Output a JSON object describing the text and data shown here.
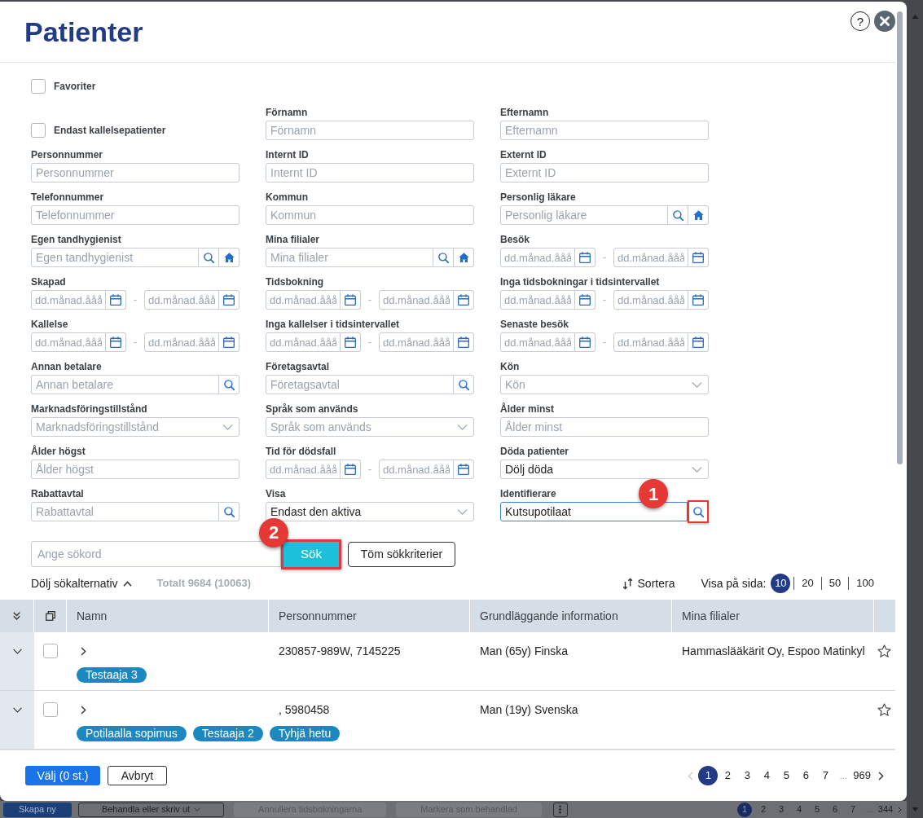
{
  "window": {
    "title": "Patienter",
    "help_label": "?"
  },
  "favorites": {
    "label": "Favoriter",
    "checked": false
  },
  "filters": [
    {
      "kind": "checkbox",
      "label": "Endast kallelsepatienter",
      "checked": false
    },
    {
      "kind": "text",
      "label": "Förnamn",
      "placeholder": "Förnamn",
      "focused": false
    },
    {
      "kind": "text",
      "label": "Efternamn",
      "placeholder": "Efternamn",
      "focused": false
    },
    {
      "kind": "text",
      "label": "Personnummer",
      "placeholder": "Personnummer",
      "focused": false
    },
    {
      "kind": "text",
      "label": "Internt ID",
      "placeholder": "Internt ID",
      "focused": false
    },
    {
      "kind": "text",
      "label": "Externt ID",
      "placeholder": "Externt ID",
      "focused": false
    },
    {
      "kind": "text",
      "label": "Telefonnummer",
      "placeholder": "Telefonnummer",
      "focused": false
    },
    {
      "kind": "text",
      "label": "Kommun",
      "placeholder": "Kommun",
      "focused": false
    },
    {
      "kind": "lookup",
      "label": "Personlig läkare",
      "placeholder": "Personlig läkare",
      "focused": false
    },
    {
      "kind": "lookup",
      "label": "Egen tandhygienist",
      "placeholder": "Egen tandhygienist",
      "focused": false
    },
    {
      "kind": "lookup",
      "label": "Mina filialer",
      "placeholder": "Mina filialer",
      "focused": false
    },
    {
      "kind": "date_range",
      "label": "Besök",
      "from_placeholder": "dd.månad.ååå",
      "separator": "-",
      "to_placeholder": "dd.månad.ååå"
    },
    {
      "kind": "date_range",
      "label": "Skapad",
      "from_placeholder": "dd.månad.ååå",
      "separator": "-",
      "to_placeholder": "dd.månad.ååå"
    },
    {
      "kind": "date_range",
      "label": "Tidsbokning",
      "from_placeholder": "dd.månad.ååå",
      "separator": "-",
      "to_placeholder": "dd.månad.ååå"
    },
    {
      "kind": "date_range",
      "label": "Inga tidsbokningar i tidsintervallet",
      "from_placeholder": "dd.månad.ååå",
      "separator": "-",
      "to_placeholder": "dd.månad.ååå"
    },
    {
      "kind": "date_range",
      "label": "Kallelse",
      "from_placeholder": "dd.månad.ååå",
      "separator": "-",
      "to_placeholder": "dd.månad.ååå"
    },
    {
      "kind": "date_range",
      "label": "Inga kallelser i tidsintervallet",
      "from_placeholder": "dd.månad.ååå",
      "separator": "-",
      "to_placeholder": "dd.månad.ååå"
    },
    {
      "kind": "date_range",
      "label": "Senaste besök",
      "from_placeholder": "dd.månad.ååå",
      "separator": "-",
      "to_placeholder": "dd.månad.ååå"
    },
    {
      "kind": "search",
      "label": "Annan betalare",
      "placeholder": "Annan betalare",
      "focused": false
    },
    {
      "kind": "search",
      "label": "Företagsavtal",
      "placeholder": "Företagsavtal",
      "focused": false
    },
    {
      "kind": "select",
      "label": "Kön",
      "placeholder": "Kön",
      "focused": false
    },
    {
      "kind": "select",
      "label": "Marknadsföringstillstånd",
      "placeholder": "Marknadsföringstillstånd",
      "focused": false
    },
    {
      "kind": "select",
      "label": "Språk som används",
      "placeholder": "Språk som används",
      "focused": false
    },
    {
      "kind": "text",
      "label": "Ålder minst",
      "placeholder": "Ålder minst",
      "focused": false
    },
    {
      "kind": "text",
      "label": "Ålder högst",
      "placeholder": "Ålder högst",
      "focused": false
    },
    {
      "kind": "date_range",
      "label": "Tid för dödsfall",
      "from_placeholder": "dd.månad.ååå",
      "separator": "-",
      "to_placeholder": "dd.månad.ååå"
    },
    {
      "kind": "select",
      "label": "Döda patienter",
      "value": "Dölj döda",
      "focused": false
    },
    {
      "kind": "search",
      "label": "Rabattavtal",
      "placeholder": "Rabattavtal",
      "focused": false
    },
    {
      "kind": "select",
      "label": "Visa",
      "value": "Endast den aktiva",
      "focused": false
    },
    {
      "kind": "search",
      "label": "Identifierare",
      "value": "Kutsupotilaat",
      "focused": true,
      "annotation": "1"
    }
  ],
  "search": {
    "placeholder": "Ange sökord",
    "submit_label": "Sök",
    "submit_annotation": "2",
    "clear_label": "Töm sökkriterier"
  },
  "results": {
    "toggle_label": "Dölj sökalternativ",
    "total": "Totalt 9684 (10063)",
    "sort_label": "Sortera",
    "page_size_label": "Visa på sida:",
    "page_sizes": [
      {
        "label": "10",
        "selected": true
      },
      {
        "label": "20",
        "selected": false
      },
      {
        "label": "50",
        "selected": false
      },
      {
        "label": "100",
        "selected": false
      }
    ]
  },
  "table": {
    "columns": [
      "Namn",
      "Personnummer",
      "Grundläggande information",
      "Mina filialer"
    ],
    "rows": [
      {
        "checked": false,
        "favorite": false,
        "personnummer": "230857-989W, 7145225",
        "info": "Man (65y) Finska",
        "branches": "Hammaslääkärit Oy, Espoo Matinkyl",
        "tags": [
          "Testaaja 3"
        ]
      },
      {
        "checked": false,
        "favorite": false,
        "personnummer": ", 5980458",
        "info": "Man (19y) Svenska",
        "tags": [
          "Potilaalla sopimus",
          "Testaaja 2",
          "Tyhjä hetu"
        ]
      }
    ]
  },
  "footer": {
    "select_label": "Välj (0 st.)",
    "cancel_label": "Avbryt",
    "pagination": {
      "prev_disabled": true,
      "next_disabled": false,
      "pages": [
        {
          "kind": "page",
          "label": "1",
          "selected": true
        },
        {
          "kind": "page",
          "label": "2",
          "selected": false
        },
        {
          "kind": "page",
          "label": "3",
          "selected": false
        },
        {
          "kind": "page",
          "label": "4",
          "selected": false
        },
        {
          "kind": "page",
          "label": "5",
          "selected": false
        },
        {
          "kind": "page",
          "label": "6",
          "selected": false
        },
        {
          "kind": "page",
          "label": "7",
          "selected": false
        },
        {
          "kind": "ellipsis",
          "label": "...",
          "selected": false
        },
        {
          "kind": "page",
          "label": "969",
          "selected": false
        }
      ]
    }
  },
  "background_page": {
    "buttons": [
      {
        "kind": "primary",
        "label": "Skapa ny"
      },
      {
        "kind": "menu",
        "label": "Behandla eller skriv ut"
      },
      {
        "kind": "disabled",
        "label": "Annullera tidsbokningarna"
      },
      {
        "kind": "disabled",
        "label": "Markera som behandlad"
      },
      {
        "kind": "more"
      }
    ],
    "pages": [
      {
        "kind": "page",
        "label": "1",
        "selected": true
      },
      {
        "kind": "page",
        "label": "2",
        "selected": false
      },
      {
        "kind": "page",
        "label": "3",
        "selected": false
      },
      {
        "kind": "page",
        "label": "4",
        "selected": false
      },
      {
        "kind": "page",
        "label": "5",
        "selected": false
      },
      {
        "kind": "page",
        "label": "6",
        "selected": false
      },
      {
        "kind": "page",
        "label": "7",
        "selected": false
      },
      {
        "kind": "ellipsis",
        "label": "...",
        "selected": false
      },
      {
        "kind": "page",
        "label": "344",
        "selected": false
      }
    ]
  }
}
